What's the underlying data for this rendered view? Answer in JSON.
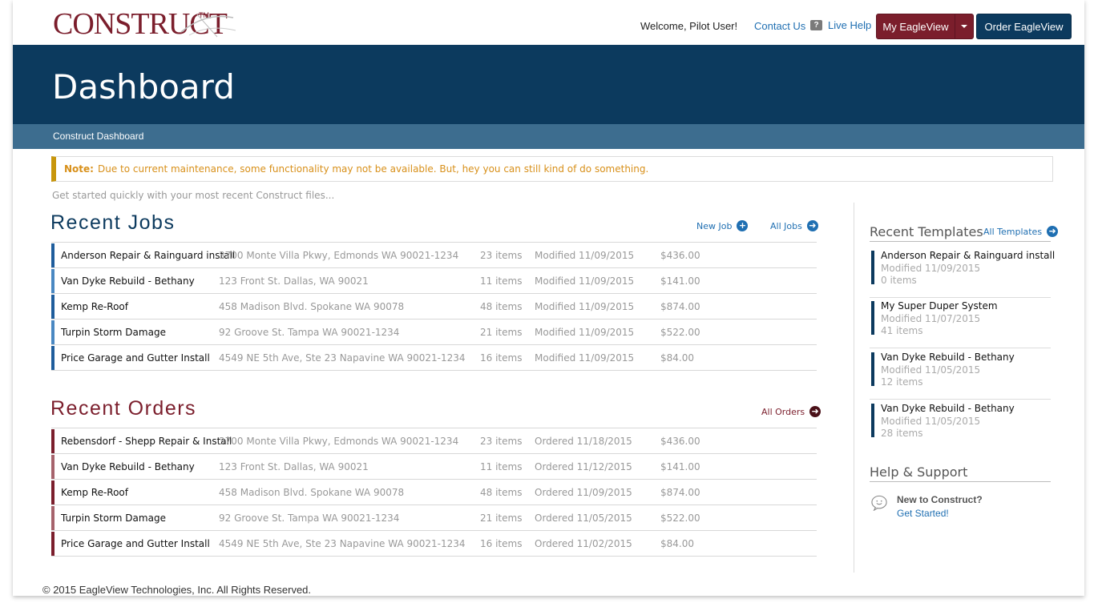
{
  "brand": {
    "logo_text": "CONSTRUCT",
    "logo_tm": "TM"
  },
  "topbar": {
    "welcome": "Welcome, Pilot User!",
    "contact": "Contact Us",
    "live_help": "Live Help",
    "my_eagleview": "My EagleView",
    "order_eagleview": "Order EagleView"
  },
  "header": {
    "title": "Dashboard",
    "breadcrumb": "Construct Dashboard"
  },
  "notice": {
    "label": "Note:",
    "text": "Due to current maintenance, some functionality may not be available. But, hey you can still kind of do something."
  },
  "intro": "Get started quickly with your most recent Construct files...",
  "jobs": {
    "title": "Recent Jobs",
    "new_job": "New Job",
    "all_jobs": "All Jobs",
    "rows": [
      {
        "name": "Anderson Repair & Rainguard install",
        "address": "3700 Monte Villa Pkwy,  Edmonds WA  90021-1234",
        "items": "23 items",
        "date": "Modified 11/09/2015",
        "price": "$436.00"
      },
      {
        "name": "Van Dyke Rebuild - Bethany",
        "address": "123 Front St. Dallas, WA  90021",
        "items": "11 items",
        "date": "Modified 11/09/2015",
        "price": "$141.00"
      },
      {
        "name": "Kemp Re-Roof",
        "address": "458 Madison Blvd. Spokane WA  90078",
        "items": "48 items",
        "date": "Modified 11/09/2015",
        "price": "$874.00"
      },
      {
        "name": "Turpin Storm Damage",
        "address": "92 Groove St. Tampa WA  90021-1234",
        "items": "21 items",
        "date": "Modified 11/09/2015",
        "price": "$522.00"
      },
      {
        "name": "Price Garage and Gutter Install",
        "address": "4549 NE 5th Ave, Ste 23 Napavine WA  90021-1234",
        "items": "16 items",
        "date": "Modified 11/09/2015",
        "price": "$84.00"
      }
    ]
  },
  "orders": {
    "title": "Recent Orders",
    "all_orders": "All Orders",
    "rows": [
      {
        "name": "Rebensdorf - Shepp Repair & Install",
        "address": "3700 Monte Villa Pkwy,  Edmonds WA  90021-1234",
        "items": "23 items",
        "date": "Ordered 11/18/2015",
        "price": "$436.00"
      },
      {
        "name": "Van Dyke Rebuild - Bethany",
        "address": "123 Front St. Dallas, WA  90021",
        "items": "11 items",
        "date": "Ordered 11/12/2015",
        "price": "$141.00"
      },
      {
        "name": "Kemp Re-Roof",
        "address": "458 Madison Blvd. Spokane WA  90078",
        "items": "48 items",
        "date": "Ordered 11/09/2015",
        "price": "$874.00"
      },
      {
        "name": "Turpin Storm Damage",
        "address": "92 Groove St. Tampa WA  90021-1234",
        "items": "21 items",
        "date": "Ordered 11/05/2015",
        "price": "$522.00"
      },
      {
        "name": "Price Garage and Gutter Install",
        "address": "4549 NE 5th Ave, Ste 23 Napavine WA  90021-1234",
        "items": "16 items",
        "date": "Ordered 11/02/2015",
        "price": "$84.00"
      }
    ]
  },
  "templates": {
    "title": "Recent Templates",
    "all_templates": "All Templates",
    "items": [
      {
        "name": "Anderson Repair & Rainguard install",
        "modified": "Modified 11/09/2015",
        "items": "0 items"
      },
      {
        "name": "My Super Duper System",
        "modified": "Modified 11/07/2015",
        "items": "41 items"
      },
      {
        "name": "Van Dyke Rebuild - Bethany",
        "modified": "Modified 11/05/2015",
        "items": "12 items"
      },
      {
        "name": "Van Dyke Rebuild - Bethany",
        "modified": "Modified 11/05/2015",
        "items": "28 items"
      }
    ]
  },
  "support": {
    "title": "Help & Support",
    "question": "New to Construct?",
    "link": "Get Started!"
  },
  "footer": "© 2015 EagleView Technologies, Inc. All Rights Reserved.",
  "colors": {
    "brand_red": "#7b1e2c",
    "navy": "#0c3a5e",
    "subnav": "#3d6d8f",
    "link_blue": "#1f6fb2",
    "notice": "#c8960c",
    "job_bar_dark": "#1f5d9c",
    "job_bar_light": "#4a88c2",
    "order_bar_dark": "#7b1e2c",
    "order_bar_light": "#a6636c"
  }
}
